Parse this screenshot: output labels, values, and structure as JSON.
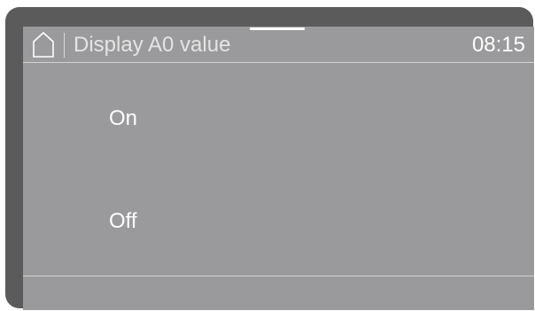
{
  "header": {
    "home_icon": "home-icon",
    "title": "Display A0 value",
    "clock": "08:15"
  },
  "options": [
    {
      "label": "On"
    },
    {
      "label": "Off"
    }
  ],
  "colors": {
    "bezel": "#5b5b5b",
    "screen": "#9a9a9c",
    "text": "#ffffff",
    "divider": "#d2d2d2"
  }
}
